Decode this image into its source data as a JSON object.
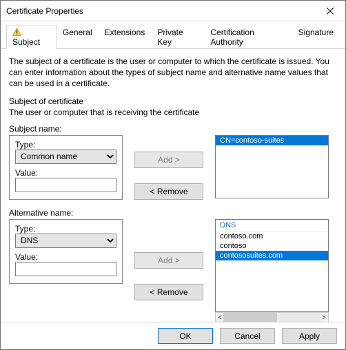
{
  "window": {
    "title": "Certificate Properties"
  },
  "tabs": {
    "subject": "Subject",
    "general": "General",
    "extensions": "Extensions",
    "private_key": "Private Key",
    "cert_authority": "Certification Authority",
    "signature": "Signature"
  },
  "description": "The subject of a certificate is the user or computer to which the certificate is issued. You can enter information about the types of subject name and alternative name values that can be used in a certificate.",
  "section": {
    "title": "Subject of certificate",
    "sub": "The user or computer that is receiving the certificate"
  },
  "subject_name": {
    "heading": "Subject name:",
    "type_label": "Type:",
    "type_value": "Common name",
    "value_label": "Value:",
    "value_text": "",
    "add_label": "Add >",
    "remove_label": "< Remove",
    "list": [
      "CN=contoso-suites"
    ],
    "selected_index": 0
  },
  "alt_name": {
    "heading": "Alternative name:",
    "type_label": "Type:",
    "type_value": "DNS",
    "value_label": "Value:",
    "value_text": "",
    "add_label": "Add >",
    "remove_label": "< Remove",
    "header": "DNS",
    "list": [
      "contoso.com",
      "contoso",
      "contososuites.com"
    ],
    "selected_index": 2
  },
  "footer": {
    "ok": "OK",
    "cancel": "Cancel",
    "apply": "Apply"
  }
}
